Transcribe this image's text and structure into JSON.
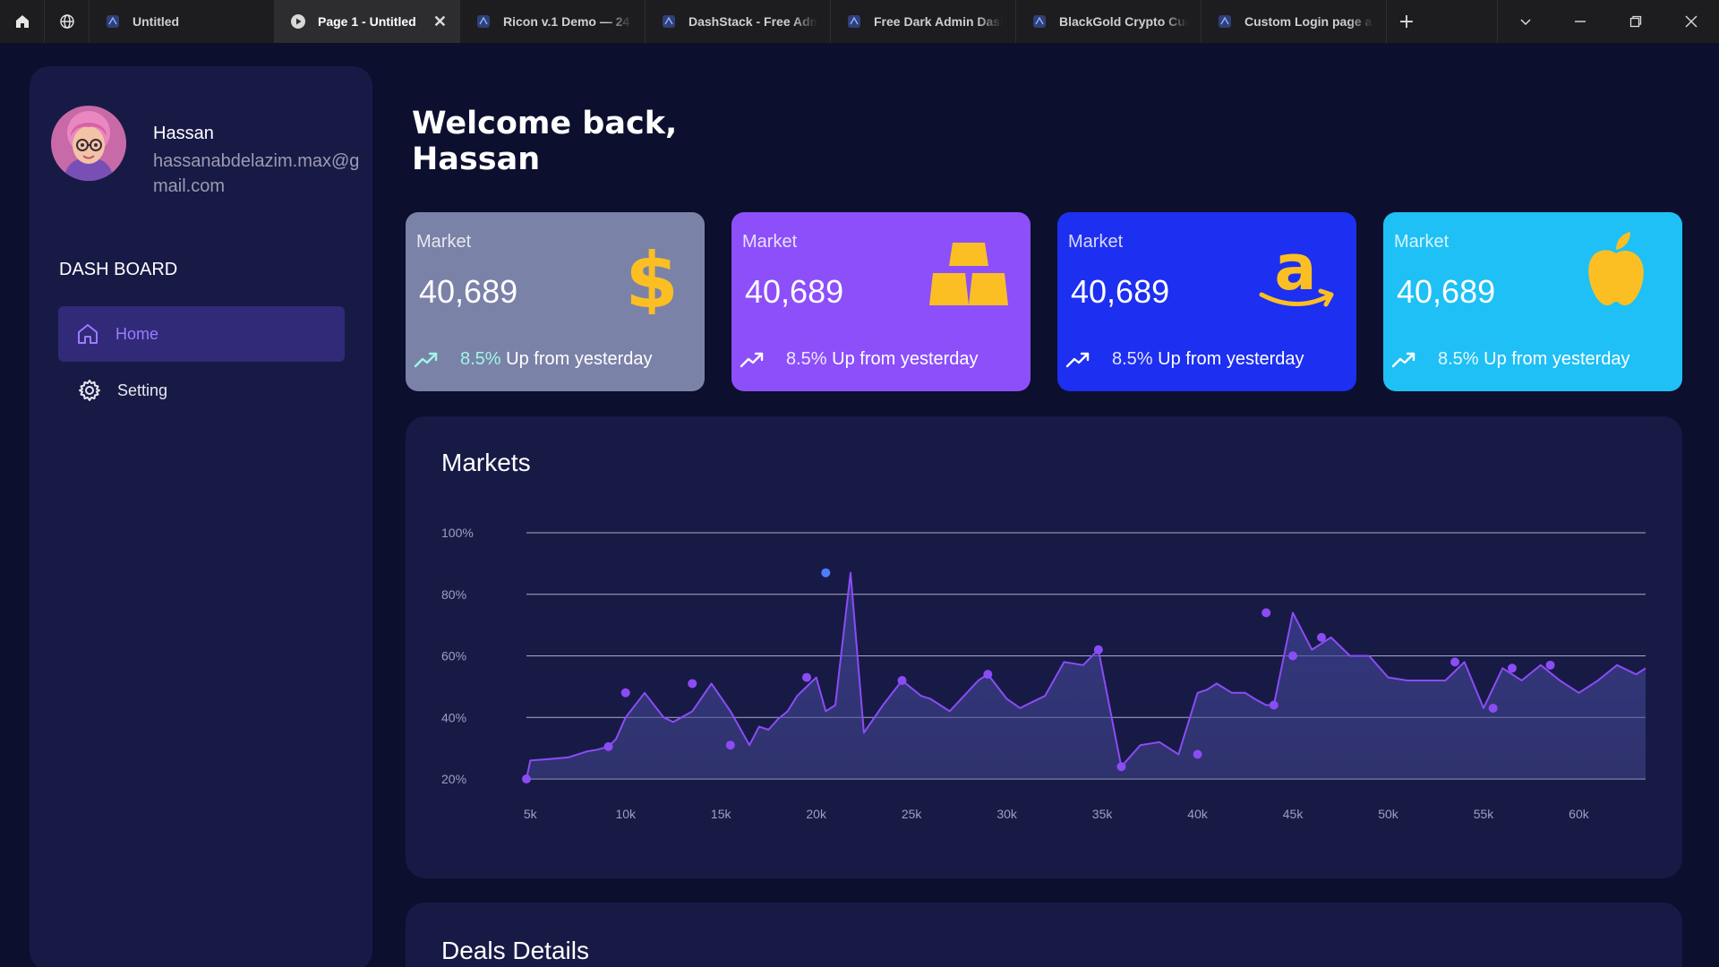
{
  "browser": {
    "tabs": [
      {
        "label": "Untitled",
        "active": false
      },
      {
        "label": "Page 1 - Untitled",
        "active": true
      },
      {
        "label": "Ricon v.1 Demo — 24",
        "active": false
      },
      {
        "label": "DashStack - Free Admin",
        "active": false
      },
      {
        "label": "Free Dark Admin Dashboard",
        "active": false
      },
      {
        "label": "BlackGold Crypto Currency",
        "active": false
      },
      {
        "label": "Custom Login page a",
        "active": false
      }
    ],
    "close_glyph": "✕",
    "newtab_glyph": "+"
  },
  "sidebar": {
    "user_name": "Hassan",
    "user_email": "hassanabdelazim.max@gmail.com",
    "section_title": "DASH BOARD",
    "items": [
      {
        "label": "Home",
        "icon": "home-icon",
        "active": true
      },
      {
        "label": "Setting",
        "icon": "gear-icon",
        "active": false
      }
    ]
  },
  "main": {
    "welcome_line1": "Welcome back,",
    "welcome_line2": "Hassan",
    "cards": [
      {
        "label": "Market",
        "value": "40,689",
        "pct": "8.5%",
        "foot": "Up from yesterday",
        "icon": "dollar-icon",
        "color": "#7b82a8"
      },
      {
        "label": "Market",
        "value": "40,689",
        "pct": "8.5%",
        "foot": "Up from yesterday",
        "icon": "gold-bars-icon",
        "color": "#8c4ffa"
      },
      {
        "label": "Market",
        "value": "40,689",
        "pct": "8.5%",
        "foot": "Up from yesterday",
        "icon": "amazon-logo-icon",
        "color": "#1d2ff0"
      },
      {
        "label": "Market",
        "value": "40,689",
        "pct": "8.5%",
        "foot": "Up from yesterday",
        "icon": "apple-logo-icon",
        "color": "#1fc0f5"
      }
    ],
    "markets_title": "Markets",
    "deals_title": "Deals Details"
  },
  "colors": {
    "accent": "#8c4ffa",
    "line": "#8b4cf5",
    "peak_point": "#4e7cff",
    "icon_gold": "#fbbf24"
  },
  "chart_data": {
    "type": "area",
    "title": "Markets",
    "xlabel": "",
    "ylabel": "",
    "x_ticks": [
      "5k",
      "10k",
      "15k",
      "20k",
      "25k",
      "30k",
      "35k",
      "40k",
      "45k",
      "50k",
      "55k",
      "60k"
    ],
    "y_ticks": [
      "20%",
      "40%",
      "60%",
      "80%",
      "100%"
    ],
    "xlim": [
      4800,
      63500
    ],
    "ylim": [
      20,
      100
    ],
    "grid": true,
    "series": [
      {
        "x": [
          4800,
          5000,
          6000,
          7000,
          8000,
          8500,
          9100,
          9500,
          10000,
          11000,
          12000,
          12500,
          13500,
          14500,
          15500,
          16500,
          17000,
          17500,
          18000,
          18500,
          19000,
          19500,
          20000,
          20500,
          21000,
          21800,
          22500,
          23500,
          24500,
          25500,
          26000,
          27000,
          28500,
          29000,
          30000,
          30700,
          31000,
          31500,
          32000,
          33000,
          34000,
          34800,
          36000,
          37000,
          38000,
          39000,
          40000,
          40500,
          41000,
          41800,
          42500,
          43000,
          43600,
          44000,
          45000,
          46000,
          47000,
          48000,
          49000,
          50000,
          51000,
          52000,
          53000,
          54000,
          55000,
          56000,
          57000,
          58000,
          59000,
          60000,
          61000,
          62000,
          63000,
          63500
        ],
        "y": [
          20,
          26,
          26.5,
          27,
          29,
          29.5,
          30.5,
          33,
          40,
          48,
          40,
          38.5,
          42,
          51,
          42,
          31,
          37,
          36,
          39.5,
          42,
          47,
          50,
          53,
          42,
          44,
          87,
          35,
          44,
          52,
          47,
          46,
          42,
          52,
          54,
          46,
          43,
          44,
          45.5,
          47,
          58,
          57,
          62,
          24,
          31,
          32,
          28,
          48,
          49,
          51,
          48,
          48,
          46,
          44,
          44,
          74,
          62,
          66,
          60,
          60,
          53,
          52,
          52,
          52,
          58,
          43,
          56,
          52,
          57,
          52,
          48,
          52,
          57,
          54,
          56
        ],
        "markers_x": [
          4800,
          9100,
          10000,
          13500,
          15500,
          19500,
          20500,
          24500,
          29000,
          34800,
          36000,
          40000,
          43600,
          44000,
          45000,
          46500,
          53500,
          55500,
          56500,
          58500
        ],
        "markers_y": [
          20,
          30.5,
          48,
          51,
          31,
          53,
          87,
          52,
          54,
          62,
          24,
          28,
          74,
          44,
          60,
          66,
          58,
          43,
          56,
          57
        ]
      }
    ]
  }
}
